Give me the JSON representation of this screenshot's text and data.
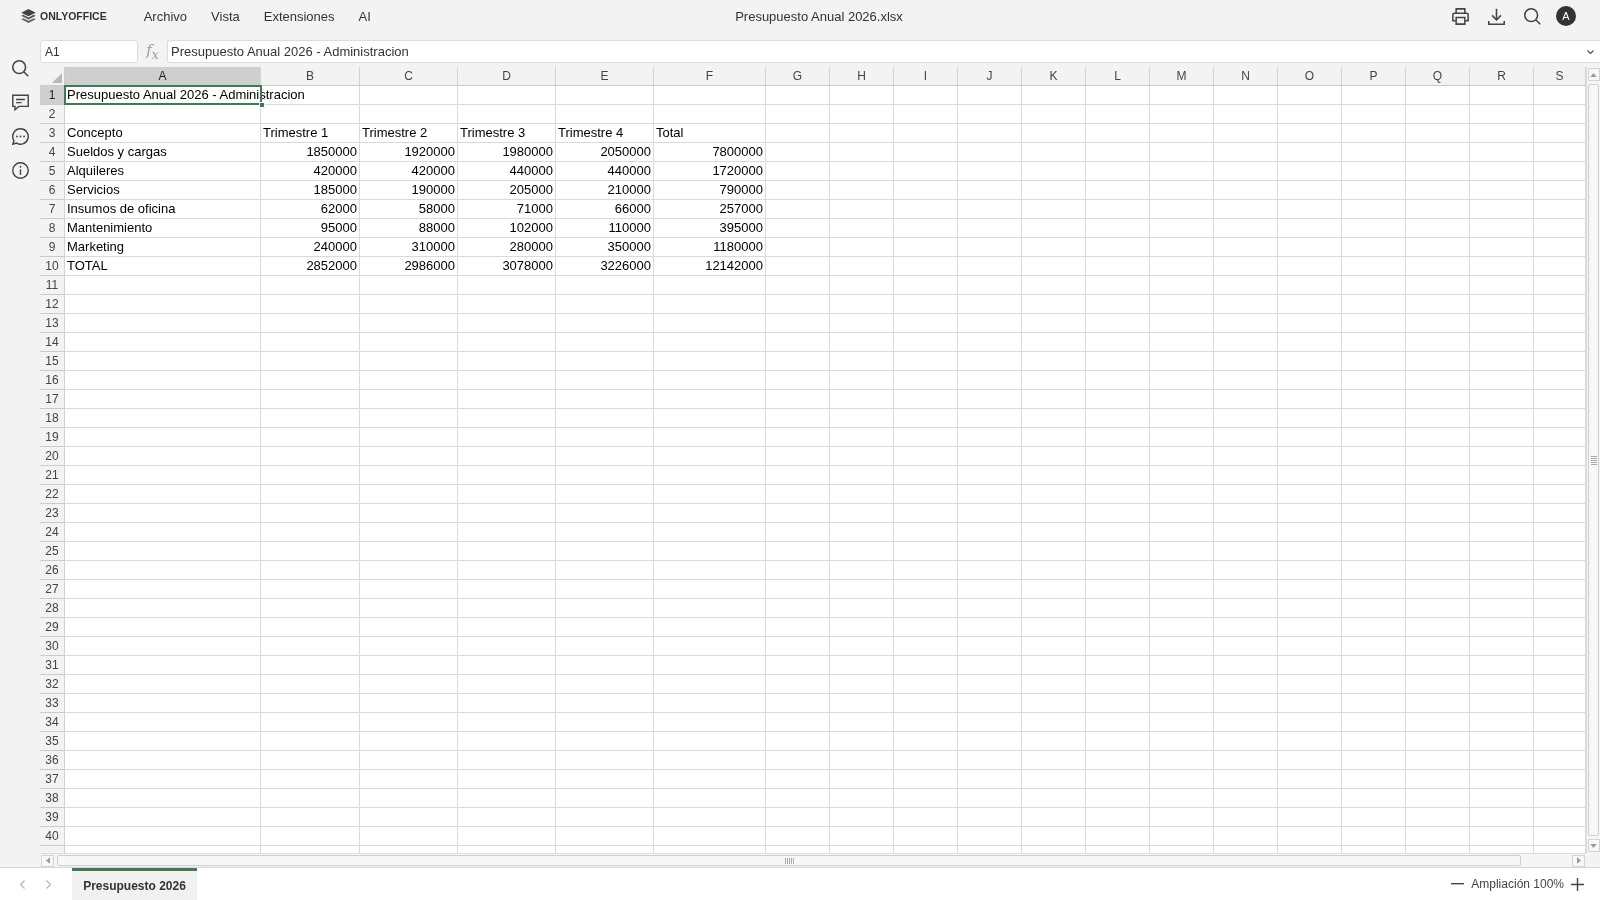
{
  "app": {
    "logo": "ONLYOFFICE",
    "menu": [
      "Archivo",
      "Vista",
      "Extensiones",
      "AI"
    ],
    "document_title": "Presupuesto Anual 2026.xlsx",
    "avatar_initial": "A"
  },
  "formula_bar": {
    "cell_reference": "A1",
    "function_label": "f$_{x}$",
    "formula": "Presupuesto Anual 2026 - Administracion"
  },
  "columns": [
    {
      "label": "A",
      "selected": true
    },
    {
      "label": "B",
      "selected": false
    },
    {
      "label": "C",
      "selected": false
    },
    {
      "label": "D",
      "selected": false
    },
    {
      "label": "E",
      "selected": false
    },
    {
      "label": "F",
      "selected": false
    },
    {
      "label": "G",
      "selected": false
    },
    {
      "label": "H",
      "selected": false
    },
    {
      "label": "I",
      "selected": false
    },
    {
      "label": "J",
      "selected": false
    },
    {
      "label": "K",
      "selected": false
    },
    {
      "label": "L",
      "selected": false
    },
    {
      "label": "M",
      "selected": false
    },
    {
      "label": "N",
      "selected": false
    },
    {
      "label": "O",
      "selected": false
    },
    {
      "label": "P",
      "selected": false
    },
    {
      "label": "Q",
      "selected": false
    },
    {
      "label": "R",
      "selected": false
    },
    {
      "label": "S",
      "selected": false
    }
  ],
  "rows": [
    {
      "number": "1",
      "selected": true,
      "cells": [
        {
          "kind": "text",
          "text": "Presupuesto Anual 2026 - Administracion"
        }
      ]
    },
    {
      "number": "2",
      "selected": false
    },
    {
      "number": "3",
      "selected": false,
      "cells": [
        {
          "kind": "text",
          "text": "Concepto"
        },
        {
          "kind": "text",
          "text": "Trimestre 1"
        },
        {
          "kind": "text",
          "text": "Trimestre 2"
        },
        {
          "kind": "text",
          "text": "Trimestre 3"
        },
        {
          "kind": "text",
          "text": "Trimestre 4"
        },
        {
          "kind": "text",
          "text": "Total"
        }
      ]
    },
    {
      "number": "4",
      "selected": false,
      "cells": [
        {
          "kind": "text",
          "text": "Sueldos y cargas"
        },
        {
          "kind": "number",
          "text": "1850000"
        },
        {
          "kind": "number",
          "text": "1920000"
        },
        {
          "kind": "number",
          "text": "1980000"
        },
        {
          "kind": "number",
          "text": "2050000"
        },
        {
          "kind": "number",
          "text": "7800000"
        }
      ]
    },
    {
      "number": "5",
      "selected": false,
      "cells": [
        {
          "kind": "text",
          "text": "Alquileres"
        },
        {
          "kind": "number",
          "text": "420000"
        },
        {
          "kind": "number",
          "text": "420000"
        },
        {
          "kind": "number",
          "text": "440000"
        },
        {
          "kind": "number",
          "text": "440000"
        },
        {
          "kind": "number",
          "text": "1720000"
        }
      ]
    },
    {
      "number": "6",
      "selected": false,
      "cells": [
        {
          "kind": "text",
          "text": "Servicios"
        },
        {
          "kind": "number",
          "text": "185000"
        },
        {
          "kind": "number",
          "text": "190000"
        },
        {
          "kind": "number",
          "text": "205000"
        },
        {
          "kind": "number",
          "text": "210000"
        },
        {
          "kind": "number",
          "text": "790000"
        }
      ]
    },
    {
      "number": "7",
      "selected": false,
      "cells": [
        {
          "kind": "text",
          "text": "Insumos de oficina"
        },
        {
          "kind": "number",
          "text": "62000"
        },
        {
          "kind": "number",
          "text": "58000"
        },
        {
          "kind": "number",
          "text": "71000"
        },
        {
          "kind": "number",
          "text": "66000"
        },
        {
          "kind": "number",
          "text": "257000"
        }
      ]
    },
    {
      "number": "8",
      "selected": false,
      "cells": [
        {
          "kind": "text",
          "text": "Mantenimiento"
        },
        {
          "kind": "number",
          "text": "95000"
        },
        {
          "kind": "number",
          "text": "88000"
        },
        {
          "kind": "number",
          "text": "102000"
        },
        {
          "kind": "number",
          "text": "110000"
        },
        {
          "kind": "number",
          "text": "395000"
        }
      ]
    },
    {
      "number": "9",
      "selected": false,
      "cells": [
        {
          "kind": "text",
          "text": "Marketing"
        },
        {
          "kind": "number",
          "text": "240000"
        },
        {
          "kind": "number",
          "text": "310000"
        },
        {
          "kind": "number",
          "text": "280000"
        },
        {
          "kind": "number",
          "text": "350000"
        },
        {
          "kind": "number",
          "text": "1180000"
        }
      ]
    },
    {
      "number": "10",
      "selected": false,
      "cells": [
        {
          "kind": "text",
          "text": "TOTAL"
        },
        {
          "kind": "number",
          "text": "2852000"
        },
        {
          "kind": "number",
          "text": "2986000"
        },
        {
          "kind": "number",
          "text": "3078000"
        },
        {
          "kind": "number",
          "text": "3226000"
        },
        {
          "kind": "number",
          "text": "12142000"
        }
      ]
    },
    {
      "number": "11",
      "selected": false
    },
    {
      "number": "12",
      "selected": false
    },
    {
      "number": "13",
      "selected": false
    },
    {
      "number": "14",
      "selected": false
    },
    {
      "number": "15",
      "selected": false
    },
    {
      "number": "16",
      "selected": false
    },
    {
      "number": "17",
      "selected": false
    },
    {
      "number": "18",
      "selected": false
    },
    {
      "number": "19",
      "selected": false
    },
    {
      "number": "20",
      "selected": false
    },
    {
      "number": "21",
      "selected": false
    },
    {
      "number": "22",
      "selected": false
    },
    {
      "number": "23",
      "selected": false
    },
    {
      "number": "24",
      "selected": false
    },
    {
      "number": "25",
      "selected": false
    },
    {
      "number": "26",
      "selected": false
    },
    {
      "number": "27",
      "selected": false
    },
    {
      "number": "28",
      "selected": false
    },
    {
      "number": "29",
      "selected": false
    },
    {
      "number": "30",
      "selected": false
    },
    {
      "number": "31",
      "selected": false
    },
    {
      "number": "32",
      "selected": false
    },
    {
      "number": "33",
      "selected": false
    },
    {
      "number": "34",
      "selected": false
    },
    {
      "number": "35",
      "selected": false
    },
    {
      "number": "36",
      "selected": false
    },
    {
      "number": "37",
      "selected": false
    },
    {
      "number": "38",
      "selected": false
    },
    {
      "number": "39",
      "selected": false
    },
    {
      "number": "40",
      "selected": false
    }
  ],
  "sheet_tabs": [
    {
      "label": "Presupuesto 2026",
      "selected": true
    }
  ],
  "status_bar": {
    "zoom": "Ampliación 100%"
  }
}
